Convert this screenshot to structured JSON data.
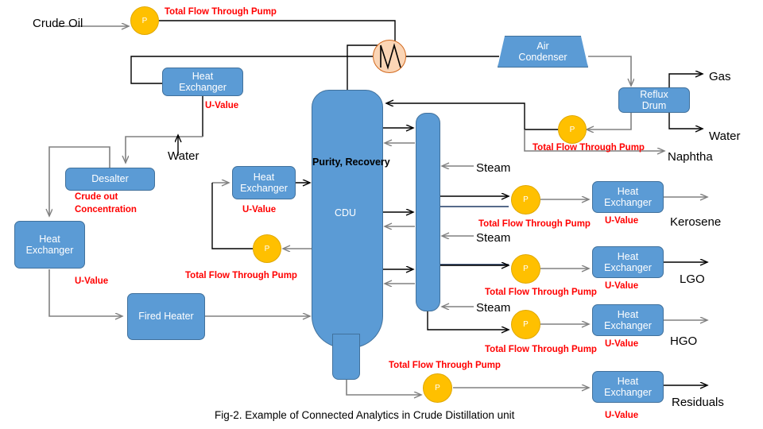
{
  "figure": {
    "caption": "Fig-2. Example of Connected Analytics in Crude Distillation unit",
    "accent_blue": "#5b9bd5",
    "accent_blue_border": "#41719c",
    "pump_yellow": "#ffc000",
    "annotation_red": "#ff0000",
    "condenser_peach": "#fbd5b5",
    "condenser_border": "#d2691e",
    "line_gray": "#808080",
    "line_black": "#000000"
  },
  "labels": {
    "crude_oil": "Crude Oil",
    "water_feed": "Water",
    "steam_1": "Steam",
    "steam_2": "Steam",
    "steam_3": "Steam",
    "gas": "Gas",
    "water_out": "Water",
    "naphtha": "Naphtha",
    "kerosene": "Kerosene",
    "lgo": "LGO",
    "hgo": "HGO",
    "residuals": "Residuals"
  },
  "annotations": {
    "total_flow": "Total Flow Through Pump",
    "u_value": "U-Value",
    "crude_out_concentration_line1": "Crude out",
    "crude_out_concentration_line2": "Concentration",
    "purity_recovery": "Purity, Recovery"
  },
  "equipment": {
    "pump_symbol": "P",
    "heat_exchanger_line1": "Heat",
    "heat_exchanger_line2": "Exchanger",
    "desalter": "Desalter",
    "fired_heater": "Fired Heater",
    "cdu": "CDU",
    "air_condenser_line1": "Air",
    "air_condenser_line2": "Condenser",
    "reflux_drum_line1": "Reflux",
    "reflux_drum_line2": "Drum"
  },
  "heat_exchangers": [
    {
      "id": "hx-preheat-top",
      "u_value": "U-Value"
    },
    {
      "id": "hx-crude-left",
      "u_value": "U-Value"
    },
    {
      "id": "hx-cdu-feed",
      "u_value": "U-Value"
    },
    {
      "id": "hx-kerosene",
      "u_value": "U-Value"
    },
    {
      "id": "hx-lgo",
      "u_value": "U-Value"
    },
    {
      "id": "hx-hgo",
      "u_value": "U-Value"
    },
    {
      "id": "hx-residuals",
      "u_value": "U-Value"
    }
  ],
  "pumps": [
    {
      "id": "pump-crude-feed",
      "symbol": "P",
      "label": "Total Flow Through Pump"
    },
    {
      "id": "pump-reflux",
      "symbol": "P",
      "label": "Total Flow Through Pump"
    },
    {
      "id": "pump-cdu-recycle",
      "symbol": "P",
      "label": "Total Flow Through Pump"
    },
    {
      "id": "pump-kerosene",
      "symbol": "P",
      "label": "Total Flow Through Pump"
    },
    {
      "id": "pump-lgo",
      "symbol": "P",
      "label": "Total Flow Through Pump"
    },
    {
      "id": "pump-hgo",
      "symbol": "P",
      "label": "Total Flow Through Pump"
    },
    {
      "id": "pump-residuals",
      "symbol": "P",
      "label": "Total Flow Through Pump"
    }
  ]
}
